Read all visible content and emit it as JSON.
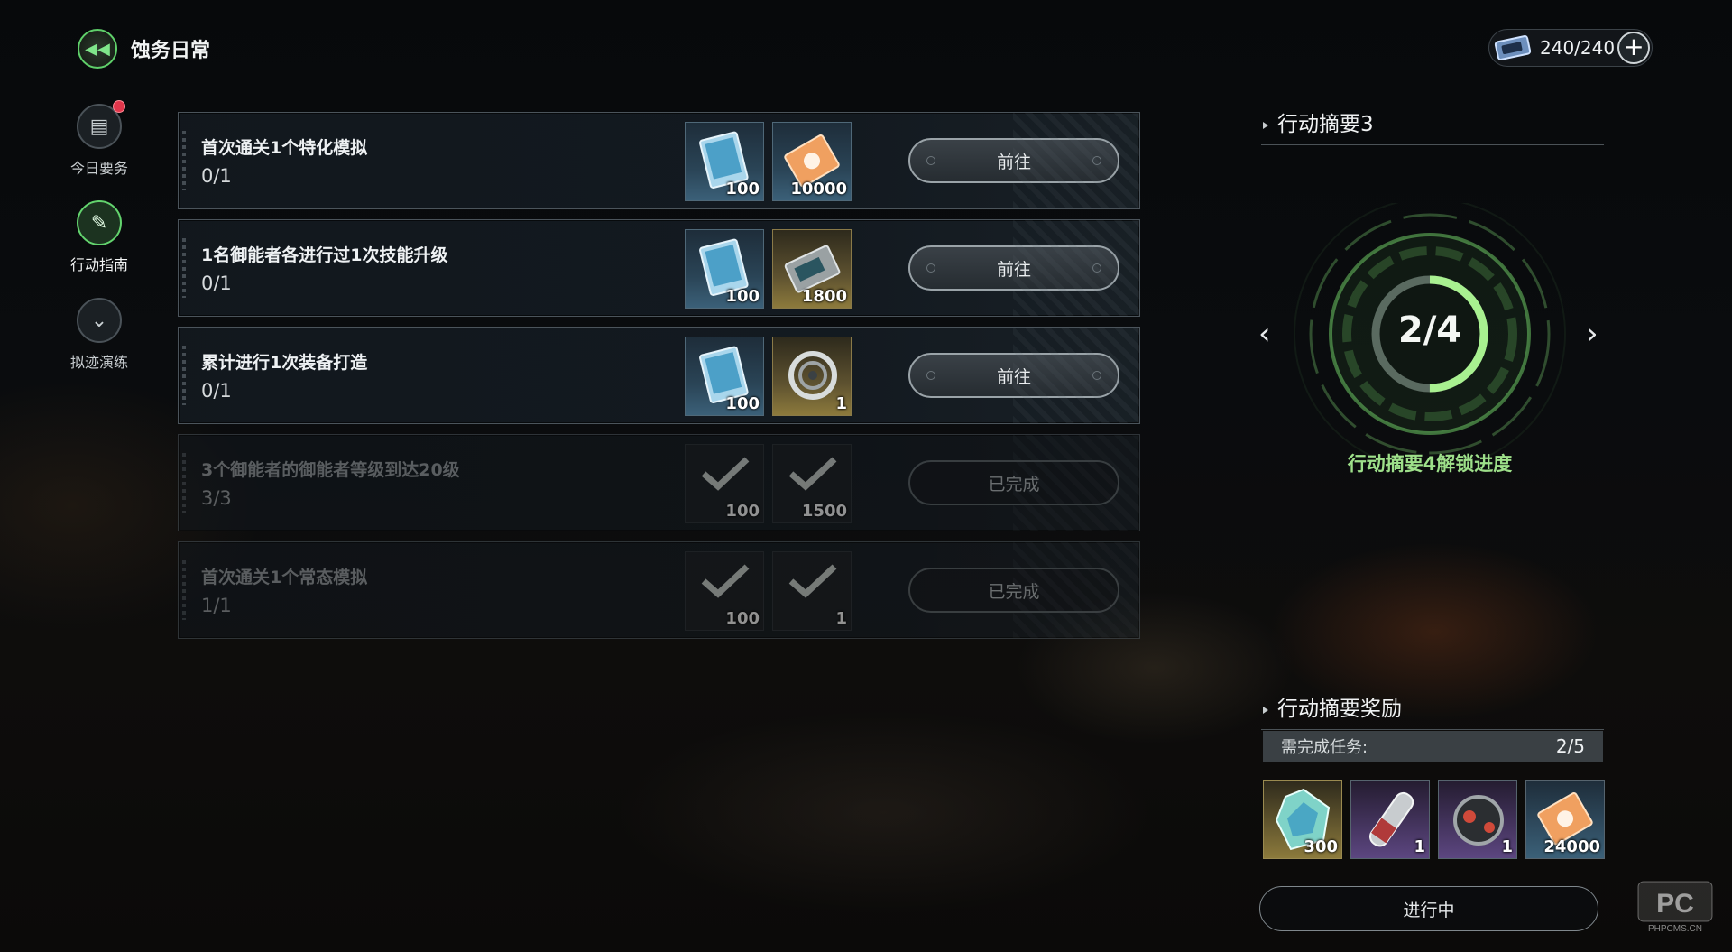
{
  "header": {
    "title": "蚀务日常",
    "stamina": "240/240"
  },
  "nav": [
    {
      "label": "今日要务",
      "icon": "calendar-icon",
      "badge": true
    },
    {
      "label": "行动指南",
      "icon": "guide-icon",
      "active": true
    },
    {
      "label": "拟迹演练",
      "icon": "chevron-badge-icon"
    }
  ],
  "tasks": [
    {
      "title": "首次通关1个特化模拟",
      "progress": "0/1",
      "rewards": [
        "100",
        "10000"
      ],
      "button": "前往",
      "done": false
    },
    {
      "title": "1名御能者各进行过1次技能升级",
      "progress": "0/1",
      "rewards": [
        "100",
        "1800"
      ],
      "button": "前往",
      "done": false
    },
    {
      "title": "累计进行1次装备打造",
      "progress": "0/1",
      "rewards": [
        "100",
        "1"
      ],
      "button": "前往",
      "done": false
    },
    {
      "title": "3个御能者的御能者等级到达20级",
      "progress": "3/3",
      "rewards": [
        "100",
        "1500"
      ],
      "button": "已完成",
      "done": true
    },
    {
      "title": "首次通关1个常态模拟",
      "progress": "1/1",
      "rewards": [
        "100",
        "1"
      ],
      "button": "已完成",
      "done": true
    }
  ],
  "summary": {
    "heading": "行动摘要3",
    "progress_text": "2/4",
    "progress_fraction": 0.5,
    "caption": "行动摘要4解锁进度"
  },
  "bonus": {
    "heading": "行动摘要奖励",
    "req_label": "需完成任务:",
    "req_value": "2/5",
    "rewards": [
      "300",
      "1",
      "1",
      "24000"
    ],
    "status": "进行中"
  },
  "watermark": {
    "text": "PHPCMS.CN"
  },
  "colors": {
    "accent_green": "#9ee08a",
    "ring_green": "#7fe06a",
    "badge_red": "#e1364b"
  }
}
